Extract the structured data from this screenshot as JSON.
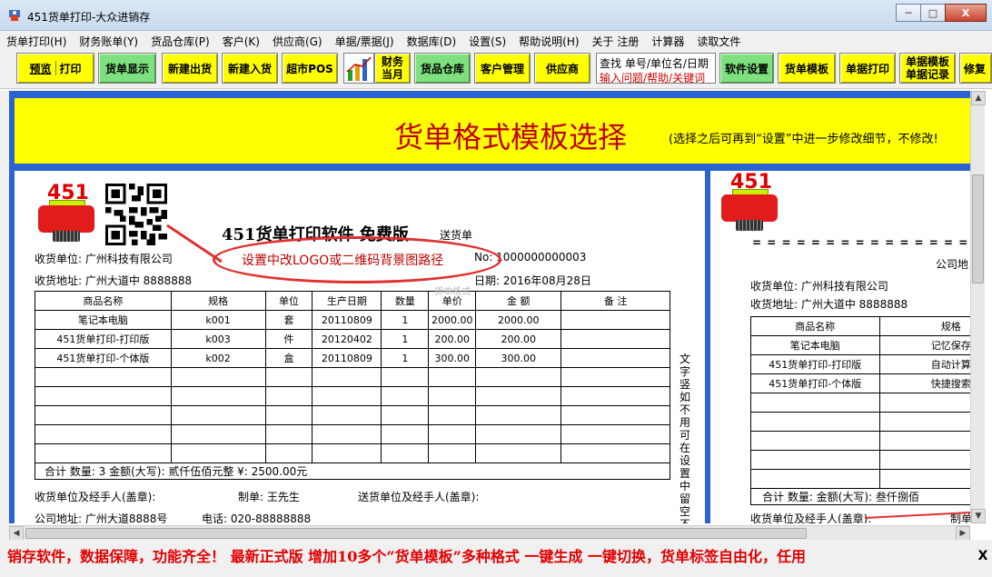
{
  "window": {
    "title": "451货单打印-大众进销存",
    "minimize_label": "─",
    "maximize_label": "□",
    "close_label": "X"
  },
  "menu": [
    "货单打印(H)",
    "财务账单(Y)",
    "货品仓库(P)",
    "客户(K)",
    "供应商(G)",
    "单据/票据(J)",
    "数据库(D)",
    "设置(S)",
    "帮助说明(H)",
    "关于 注册",
    "计算器",
    "读取文件"
  ],
  "toolbar": {
    "preview": "预览",
    "print": "打印",
    "show_invoice": "货单显示",
    "new_outbound": "新建出货",
    "new_inbound": "新建入货",
    "pos": "超市POS",
    "finance_l1": "财务",
    "finance_l2": "当月",
    "warehouse": "货品仓库",
    "customer_mgmt": "客户管理",
    "supplier": "供应商",
    "search_l1": "查找 单号/单位名/日期",
    "search_l2": "输入问题/帮助/关键词",
    "software_settings": "软件设置",
    "invoice_template": "货单模板",
    "doc_print": "单据打印",
    "doc_template_l1": "单据模板",
    "doc_template_l2": "单据记录",
    "more": "修复"
  },
  "banner": {
    "title": "货单格式模板选择",
    "subtitle": "(选择之后可再到“设置”中进一步修改细节，不修改!"
  },
  "template1": {
    "logo_number": "451",
    "heading": "451货单打印软件  免费版",
    "heading_suffix": "送货单",
    "receiver": "收货单位: 广州科技有限公司",
    "receiver_addr": "收货地址: 广州大道中   8888888",
    "number": "No: 1000000000003",
    "date": "日期: 2016年08月28日",
    "annotation": "设置中改LOGO或二维码背景图路径",
    "watermark": "货单格式",
    "columns": [
      "商品名称",
      "规格",
      "单位",
      "生产日期",
      "数量",
      "单价",
      "金 额",
      "备 注"
    ],
    "rows": [
      [
        "笔记本电脑",
        "k001",
        "套",
        "20110809",
        "1",
        "2000.00",
        "2000.00",
        ""
      ],
      [
        "451货单打印-打印版",
        "k003",
        "件",
        "20120402",
        "1",
        "200.00",
        "200.00",
        ""
      ],
      [
        "451货单打印-个体版",
        "k002",
        "盒",
        "20110809",
        "1",
        "300.00",
        "300.00",
        ""
      ]
    ],
    "total": "合计   数量: 3        金额(大写): 贰仟伍佰元整       ¥: 2500.00元",
    "sign_receiver": "收货单位及经手人(盖章):",
    "maker": "制单: 王先生",
    "sign_sender": "送货单位及经手人(盖章):",
    "company_addr": "公司地址: 广州大道8888号",
    "phone": "电话: 020-88888888",
    "vertical_note": "文字 竖 如不用可在设置中留空不显示"
  },
  "template2": {
    "logo_number": "451",
    "dashes": "= = = = = = = = = = = = = = = = = = = = = =",
    "company_label": "公司地",
    "receiver": "收货单位: 广州科技有限公司",
    "receiver_addr": "收货地址: 广州大道中   8888888",
    "columns": [
      "商品名称",
      "规格"
    ],
    "rows": [
      [
        "笔记本电脑",
        "记忆保存"
      ],
      [
        "451货单打印-打印版",
        "自动计算"
      ],
      [
        "451货单打印-个体版",
        "快捷搜索"
      ]
    ],
    "total": "合计   数量:      金额(大写): 叁仟捌佰",
    "sign_receiver": "收货单位及经手人(盖章):",
    "maker": "制单"
  },
  "ticker": {
    "text": "销存软件，数据保障，功能齐全！   最新正式版  增加10多个“货单模板”多种格式  一键生成  一键切换，货单标签自由化，任用",
    "close_label": "X"
  },
  "colors": {
    "toolbar_yellow": "#ffff00",
    "toolbar_green": "#7ee07e",
    "banner_yellow": "#ffff00",
    "banner_red": "#c00000",
    "background_blue": "#2a63d4",
    "annotation_red": "#e03030",
    "ticker_red": "#e00000"
  }
}
